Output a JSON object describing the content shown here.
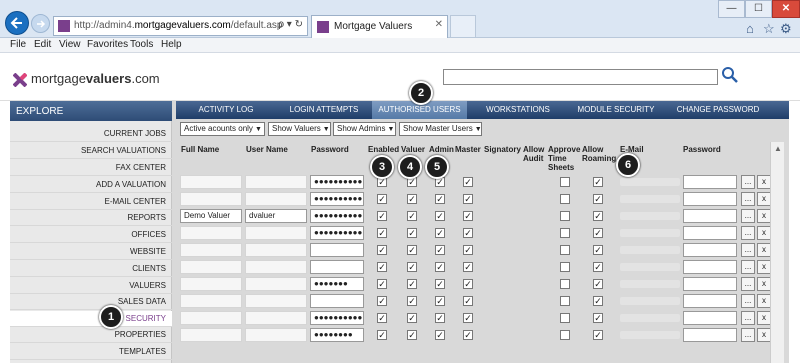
{
  "browser": {
    "url_prefix": "http://admin4.",
    "url_domain": "mortgagevaluers.com",
    "url_path": "/default.asp",
    "addr_tools": "ρ ▾ ↻",
    "tab_title": "Mortgage Valuers",
    "tab_close": "✕",
    "win_min": "—",
    "win_max": "☐",
    "win_close": "✕",
    "menu": [
      "File",
      "Edit",
      "View",
      "Favorites",
      "Tools",
      "Help"
    ]
  },
  "site": {
    "logo_plain": "mortgage",
    "logo_bold": "valuers",
    "logo_suffix": ".com",
    "search_value": ""
  },
  "sidebar": {
    "title": "EXPLORE",
    "items": [
      "CURRENT JOBS",
      "SEARCH VALUATIONS",
      "FAX CENTER",
      "ADD A VALUATION",
      "E-MAIL CENTER",
      "REPORTS",
      "OFFICES",
      "WEBSITE",
      "CLIENTS",
      "VALUERS",
      "SALES DATA",
      "SECURITY",
      "PROPERTIES",
      "TEMPLATES"
    ],
    "active": "SECURITY"
  },
  "tabs": [
    "ACTIVITY LOG",
    "LOGIN ATTEMPTS",
    "AUTHORISED USERS",
    "WORKSTATIONS",
    "MODULE SECURITY",
    "CHANGE PASSWORD"
  ],
  "active_tab": "AUTHORISED USERS",
  "filters": [
    "Active acounts only",
    "Show Valuers",
    "Show Admins",
    "Show Master Users"
  ],
  "columns": {
    "full_name": "Full Name",
    "user_name": "User Name",
    "password": "Password",
    "enabled": "Enabled",
    "valuer": "Valuer",
    "admin": "Admin",
    "master": "Master",
    "signatory": "Signatory",
    "allow_audit": [
      "Allow",
      "Audit"
    ],
    "approve_time_sheets": [
      "Approve",
      "Time",
      "Sheets"
    ],
    "allow_roaming": [
      "Allow",
      "Roaming"
    ],
    "email": "E-Mail",
    "password2": "Password"
  },
  "rows": [
    {
      "full_name": "",
      "user_name": "",
      "password": "●●●●●●●●●●",
      "enabled": true,
      "valuer": true,
      "admin": true,
      "master": true,
      "roaming": true
    },
    {
      "full_name": "",
      "user_name": "",
      "password": "●●●●●●●●●●",
      "enabled": true,
      "valuer": true,
      "admin": true,
      "master": true,
      "roaming": true
    },
    {
      "full_name": "",
      "user_name": "",
      "password": "●●●●●●●●●●",
      "enabled": true,
      "valuer": true,
      "admin": true,
      "master": true,
      "roaming": true
    },
    {
      "full_name": "Demo Valuer",
      "user_name": "dvaluer",
      "password": "●●●●●●●●●●",
      "enabled": true,
      "valuer": true,
      "admin": true,
      "master": true,
      "roaming": true
    },
    {
      "full_name": "",
      "user_name": "",
      "password": "●●●●●●●●●●",
      "enabled": true,
      "valuer": true,
      "admin": true,
      "master": true,
      "roaming": true
    },
    {
      "full_name": "",
      "user_name": "",
      "password": "",
      "enabled": true,
      "valuer": true,
      "admin": true,
      "master": true,
      "roaming": true
    },
    {
      "full_name": "",
      "user_name": "",
      "password": "",
      "enabled": true,
      "valuer": true,
      "admin": true,
      "master": true,
      "roaming": true
    },
    {
      "full_name": "",
      "user_name": "",
      "password": "●●●●●●●",
      "enabled": true,
      "valuer": true,
      "admin": true,
      "master": true,
      "roaming": true
    },
    {
      "full_name": "",
      "user_name": "",
      "password": "",
      "enabled": true,
      "valuer": true,
      "admin": true,
      "master": true,
      "roaming": true
    },
    {
      "full_name": "",
      "user_name": "",
      "password": "●●●●●●●●●●",
      "enabled": true,
      "valuer": true,
      "admin": true,
      "master": true,
      "roaming": true
    },
    {
      "full_name": "",
      "user_name": "",
      "password": "●●●●●●●●",
      "enabled": true,
      "valuer": true,
      "admin": true,
      "master": true,
      "roaming": true
    }
  ],
  "row_button_more": "...",
  "row_button_delete": "x",
  "check_glyph": "✓",
  "scroll_up": "▲",
  "markers": [
    "1",
    "2",
    "3",
    "4",
    "5",
    "6"
  ],
  "colors": {
    "accent": "#7a3f8c",
    "nav_dark": "#1f3d68",
    "nav_light": "#4a6893"
  }
}
